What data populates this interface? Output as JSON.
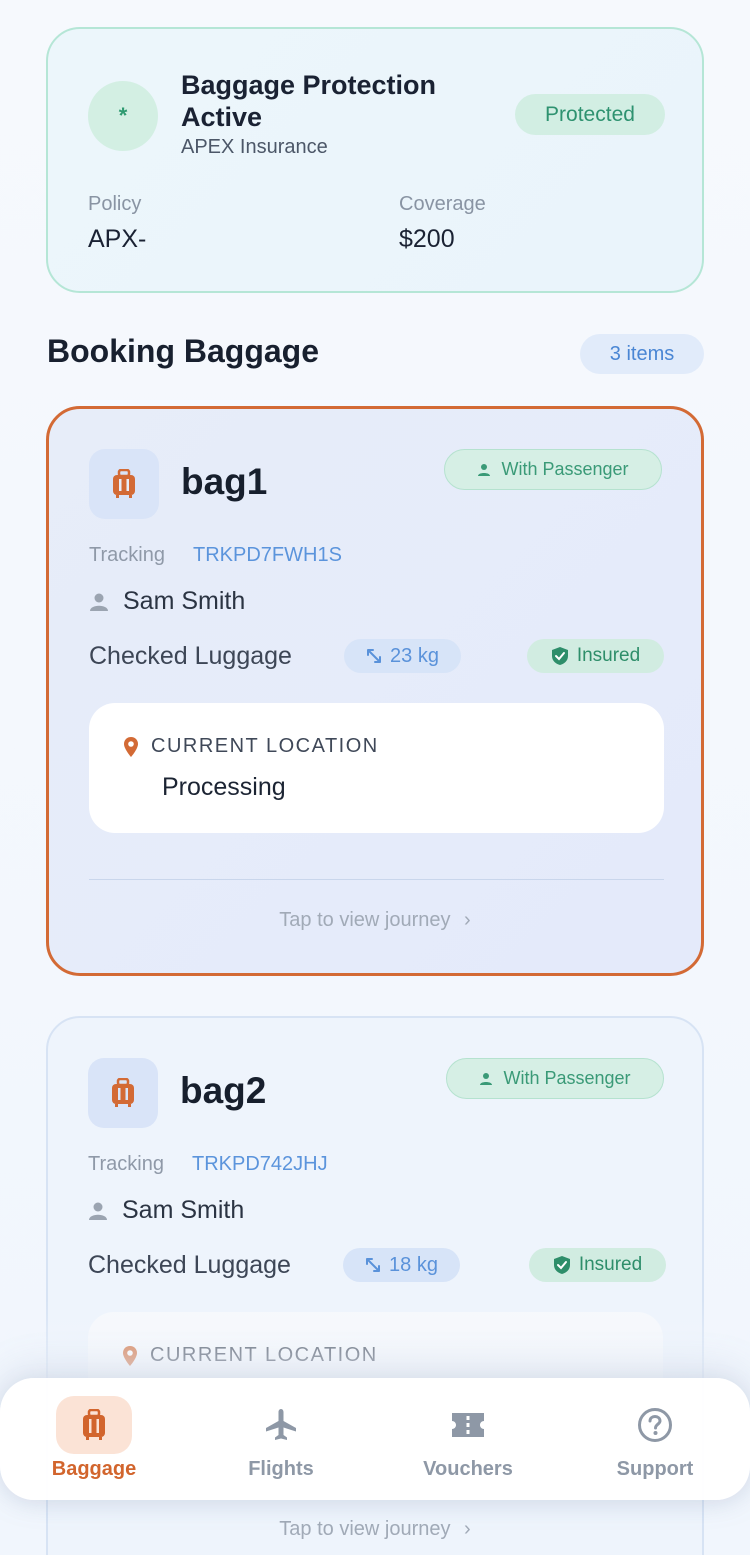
{
  "insurance": {
    "icon_text": "*",
    "title": "Baggage Protection Active",
    "provider": "APEX Insurance",
    "status": "Protected",
    "policy_label": "Policy",
    "policy_value": "APX-",
    "coverage_label": "Coverage",
    "coverage_value": "$200"
  },
  "section": {
    "title": "Booking Baggage",
    "count": "3 items"
  },
  "bags": [
    {
      "name": "bag1",
      "status": "With Passenger",
      "tracking_label": "Tracking",
      "tracking_code": "TRKPD7FWH1S",
      "passenger": "Sam Smith",
      "type": "Checked Luggage",
      "weight": "23 kg",
      "insured": "Insured",
      "location_label": "CURRENT LOCATION",
      "location_value": "Processing",
      "journey_link": "Tap to view journey"
    },
    {
      "name": "bag2",
      "status": "With Passenger",
      "tracking_label": "Tracking",
      "tracking_code": "TRKPD742JHJ",
      "passenger": "Sam Smith",
      "type": "Checked Luggage",
      "weight": "18 kg",
      "insured": "Insured",
      "location_label": "CURRENT LOCATION",
      "journey_link": "Tap to view journey"
    }
  ],
  "nav": {
    "items": [
      {
        "label": "Baggage",
        "icon": "luggage-icon",
        "active": true
      },
      {
        "label": "Flights",
        "icon": "airplane-icon",
        "active": false
      },
      {
        "label": "Vouchers",
        "icon": "ticket-icon",
        "active": false
      },
      {
        "label": "Support",
        "icon": "help-circle-icon",
        "active": false
      }
    ]
  },
  "colors": {
    "accent": "#d36a35",
    "success": "#2e9270",
    "link": "#5b94dc"
  }
}
